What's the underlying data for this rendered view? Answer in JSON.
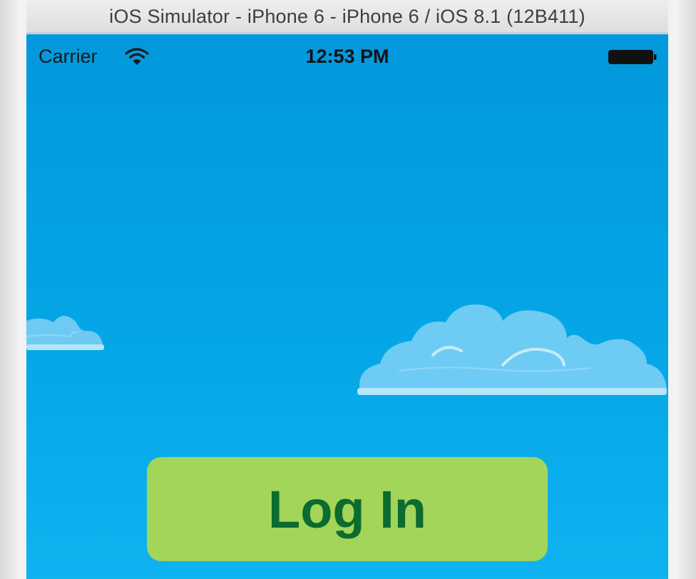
{
  "window": {
    "title": "iOS Simulator - iPhone 6 - iPhone 6 / iOS 8.1 (12B411)"
  },
  "status_bar": {
    "carrier": "Carrier",
    "time": "12:53 PM",
    "icons": [
      "wifi-icon",
      "battery-icon"
    ]
  },
  "scene": {
    "background_color": "#03A3E3",
    "decorations": [
      "cloud-left",
      "cloud-right"
    ]
  },
  "login": {
    "label": "Log In",
    "button_color": "#A3D55A",
    "text_color": "#0C6B2E"
  }
}
